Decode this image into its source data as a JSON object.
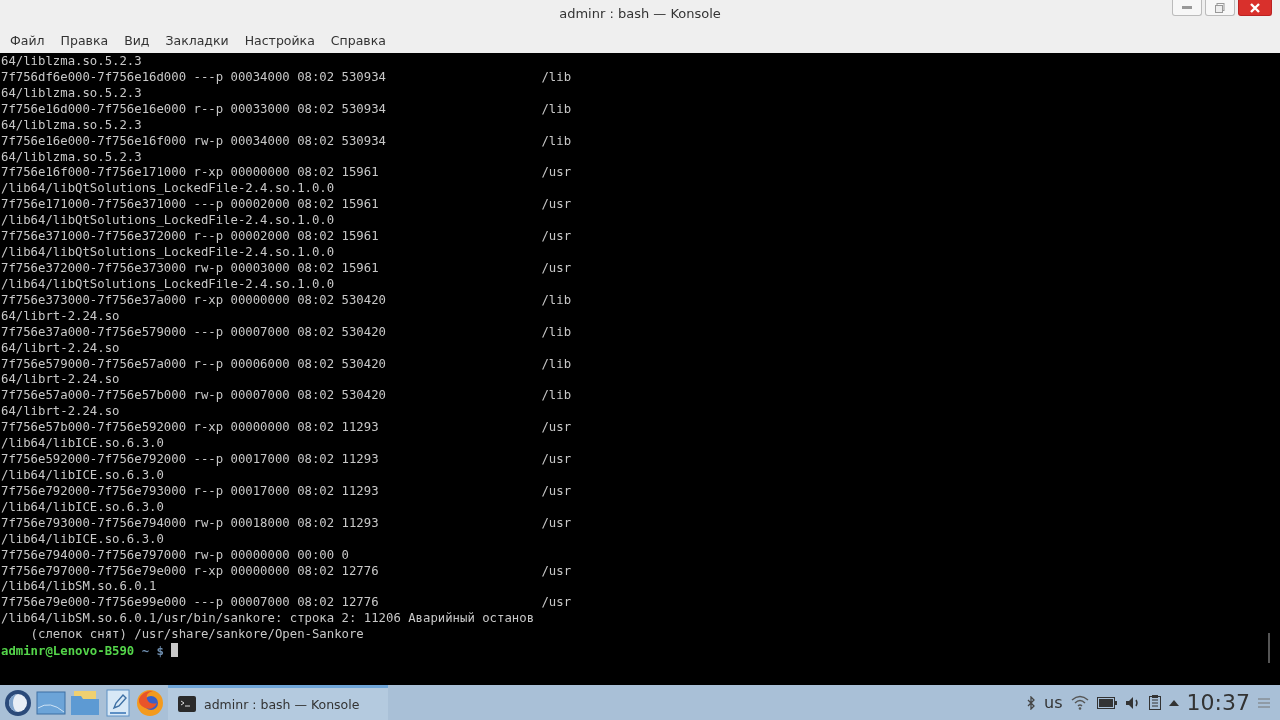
{
  "window": {
    "title": "adminr : bash — Konsole"
  },
  "menu": [
    "Файл",
    "Правка",
    "Вид",
    "Закладки",
    "Настройка",
    "Справка"
  ],
  "terminal": {
    "lines": [
      {
        "text": "64/liblzma.so.5.2.3"
      },
      {
        "text": "7f756df6e000-7f756e16d000 ---p 00034000 08:02 530934",
        "tail": "/lib"
      },
      {
        "text": "64/liblzma.so.5.2.3"
      },
      {
        "text": "7f756e16d000-7f756e16e000 r--p 00033000 08:02 530934",
        "tail": "/lib"
      },
      {
        "text": "64/liblzma.so.5.2.3"
      },
      {
        "text": "7f756e16e000-7f756e16f000 rw-p 00034000 08:02 530934",
        "tail": "/lib"
      },
      {
        "text": "64/liblzma.so.5.2.3"
      },
      {
        "text": "7f756e16f000-7f756e171000 r-xp 00000000 08:02 15961",
        "tail": "/usr"
      },
      {
        "text": "/lib64/libQtSolutions_LockedFile-2.4.so.1.0.0"
      },
      {
        "text": "7f756e171000-7f756e371000 ---p 00002000 08:02 15961",
        "tail": "/usr"
      },
      {
        "text": "/lib64/libQtSolutions_LockedFile-2.4.so.1.0.0"
      },
      {
        "text": "7f756e371000-7f756e372000 r--p 00002000 08:02 15961",
        "tail": "/usr"
      },
      {
        "text": "/lib64/libQtSolutions_LockedFile-2.4.so.1.0.0"
      },
      {
        "text": "7f756e372000-7f756e373000 rw-p 00003000 08:02 15961",
        "tail": "/usr"
      },
      {
        "text": "/lib64/libQtSolutions_LockedFile-2.4.so.1.0.0"
      },
      {
        "text": "7f756e373000-7f756e37a000 r-xp 00000000 08:02 530420",
        "tail": "/lib"
      },
      {
        "text": "64/librt-2.24.so"
      },
      {
        "text": "7f756e37a000-7f756e579000 ---p 00007000 08:02 530420",
        "tail": "/lib"
      },
      {
        "text": "64/librt-2.24.so"
      },
      {
        "text": "7f756e579000-7f756e57a000 r--p 00006000 08:02 530420",
        "tail": "/lib"
      },
      {
        "text": "64/librt-2.24.so"
      },
      {
        "text": "7f756e57a000-7f756e57b000 rw-p 00007000 08:02 530420",
        "tail": "/lib"
      },
      {
        "text": "64/librt-2.24.so"
      },
      {
        "text": "7f756e57b000-7f756e592000 r-xp 00000000 08:02 11293",
        "tail": "/usr"
      },
      {
        "text": "/lib64/libICE.so.6.3.0"
      },
      {
        "text": "7f756e592000-7f756e792000 ---p 00017000 08:02 11293",
        "tail": "/usr"
      },
      {
        "text": "/lib64/libICE.so.6.3.0"
      },
      {
        "text": "7f756e792000-7f756e793000 r--p 00017000 08:02 11293",
        "tail": "/usr"
      },
      {
        "text": "/lib64/libICE.so.6.3.0"
      },
      {
        "text": "7f756e793000-7f756e794000 rw-p 00018000 08:02 11293",
        "tail": "/usr"
      },
      {
        "text": "/lib64/libICE.so.6.3.0"
      },
      {
        "text": "7f756e794000-7f756e797000 rw-p 00000000 00:00 0"
      },
      {
        "text": "7f756e797000-7f756e79e000 r-xp 00000000 08:02 12776",
        "tail": "/usr"
      },
      {
        "text": "/lib64/libSM.so.6.0.1"
      },
      {
        "text": "7f756e79e000-7f756e99e000 ---p 00007000 08:02 12776",
        "tail": "/usr"
      },
      {
        "text": "/lib64/libSM.so.6.0.1/usr/bin/sankore: строка 2: 11206 Аварийный останов"
      },
      {
        "text": "    (слепок снят) /usr/share/sankore/Open-Sankore"
      }
    ],
    "prompt": {
      "user_host": "adminr@Lenovo-B590",
      "path": "~",
      "symbol": "$"
    }
  },
  "taskbar": {
    "tasks": [
      {
        "label": "adminr : bash — Konsole",
        "selected": true
      }
    ],
    "keyboard_layout": "us",
    "clock": "10:37"
  }
}
